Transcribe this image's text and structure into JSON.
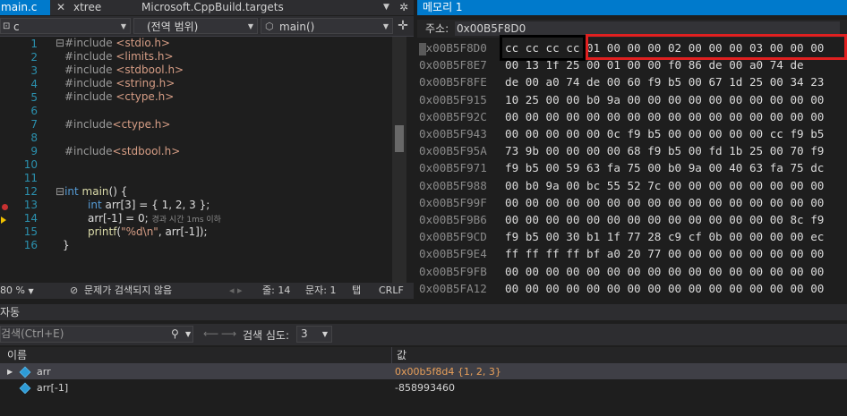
{
  "editor": {
    "tabs": {
      "main": "main.c",
      "main_close": "✕",
      "xtree": "xtree",
      "targets": "Microsoft.CppBuild.targets"
    },
    "nav": {
      "file": "c",
      "scope": "(전역 범위)",
      "function": "main()"
    },
    "lines": [
      {
        "n": "1",
        "code": "#include <stdio.h>"
      },
      {
        "n": "2",
        "code": "#include <limits.h>"
      },
      {
        "n": "3",
        "code": "#include <stdbool.h>"
      },
      {
        "n": "4",
        "code": "#include <string.h>"
      },
      {
        "n": "5",
        "code": "#include <ctype.h>"
      },
      {
        "n": "6",
        "code": ""
      },
      {
        "n": "7",
        "code": "#include<ctype.h>"
      },
      {
        "n": "8",
        "code": ""
      },
      {
        "n": "9",
        "code": "#include<stdbool.h>"
      },
      {
        "n": "10",
        "code": ""
      },
      {
        "n": "11",
        "code": ""
      },
      {
        "n": "12",
        "code": "int main() {"
      },
      {
        "n": "13",
        "code": "int arr[3] = { 1, 2, 3 };"
      },
      {
        "n": "14",
        "code": "arr[-1] = 0;"
      },
      {
        "n": "15",
        "code": "printf(\"%d\\n\", arr[-1]);"
      },
      {
        "n": "16",
        "code": "}"
      }
    ],
    "timing": "경과 시간 1ms 이하",
    "status": {
      "zoom": "80 %",
      "issues": "문제가 검색되지 않음",
      "line": "줄: 14",
      "char": "문자: 1",
      "tab": "탭",
      "eol": "CRLF"
    }
  },
  "memory": {
    "title": "메모리 1",
    "address_label": "주소:",
    "address_value": "0x00B5F8D0",
    "rows": [
      {
        "addr": "0x00B5F8D0",
        "bytes": "cc cc cc cc 01 00 00 00 02 00 00 00 03 00 00 00"
      },
      {
        "addr": "0x00B5F8E7",
        "bytes": "00 13 1f 25 00 01 00 00 f0 86 de 00 a0 74 de"
      },
      {
        "addr": "0x00B5F8FE",
        "bytes": "de 00 a0 74 de 00 60 f9 b5 00 67 1d 25 00 34 23"
      },
      {
        "addr": "0x00B5F915",
        "bytes": "10 25 00 00 b0 9a 00 00 00 00 00 00 00 00 00 00"
      },
      {
        "addr": "0x00B5F92C",
        "bytes": "00 00 00 00 00 00 00 00 00 00 00 00 00 00 00 00"
      },
      {
        "addr": "0x00B5F943",
        "bytes": "00 00 00 00 00 0c f9 b5 00 00 00 00 00 cc f9 b5"
      },
      {
        "addr": "0x00B5F95A",
        "bytes": "73 9b 00 00 00 00 68 f9 b5 00 fd 1b 25 00 70 f9"
      },
      {
        "addr": "0x00B5F971",
        "bytes": "f9 b5 00 59 63 fa 75 00 b0 9a 00 40 63 fa 75 dc"
      },
      {
        "addr": "0x00B5F988",
        "bytes": "00 b0 9a 00 bc 55 52 7c 00 00 00 00 00 00 00 00"
      },
      {
        "addr": "0x00B5F99F",
        "bytes": "00 00 00 00 00 00 00 00 00 00 00 00 00 00 00 00"
      },
      {
        "addr": "0x00B5F9B6",
        "bytes": "00 00 00 00 00 00 00 00 00 00 00 00 00 00 8c f9"
      },
      {
        "addr": "0x00B5F9CD",
        "bytes": "f9 b5 00 30 b1 1f 77 28 c9 cf 0b 00 00 00 00 ec"
      },
      {
        "addr": "0x00B5F9E4",
        "bytes": "ff ff ff ff bf a0 20 77 00 00 00 00 00 00 00 00"
      },
      {
        "addr": "0x00B5F9FB",
        "bytes": "00 00 00 00 00 00 00 00 00 00 00 00 00 00 00 00"
      },
      {
        "addr": "0x00B5FA12",
        "bytes": "00 00 00 00 00 00 00 00 00 00 00 00 00 00 00 00"
      }
    ]
  },
  "autos": {
    "title": "자동",
    "search_placeholder": "검색(Ctrl+E)",
    "depth_label": "검색 심도:",
    "depth_value": "3",
    "columns": {
      "name": "이름",
      "value": "값"
    },
    "rows": [
      {
        "name": "arr",
        "value": "0x00b5f8d4 {1, 2, 3}"
      },
      {
        "name": "arr[-1]",
        "value": "-858993460"
      }
    ]
  },
  "colors": {
    "accent": "#007acc",
    "highlight_box": "#e02020",
    "changed_value": "#e9a05a"
  }
}
